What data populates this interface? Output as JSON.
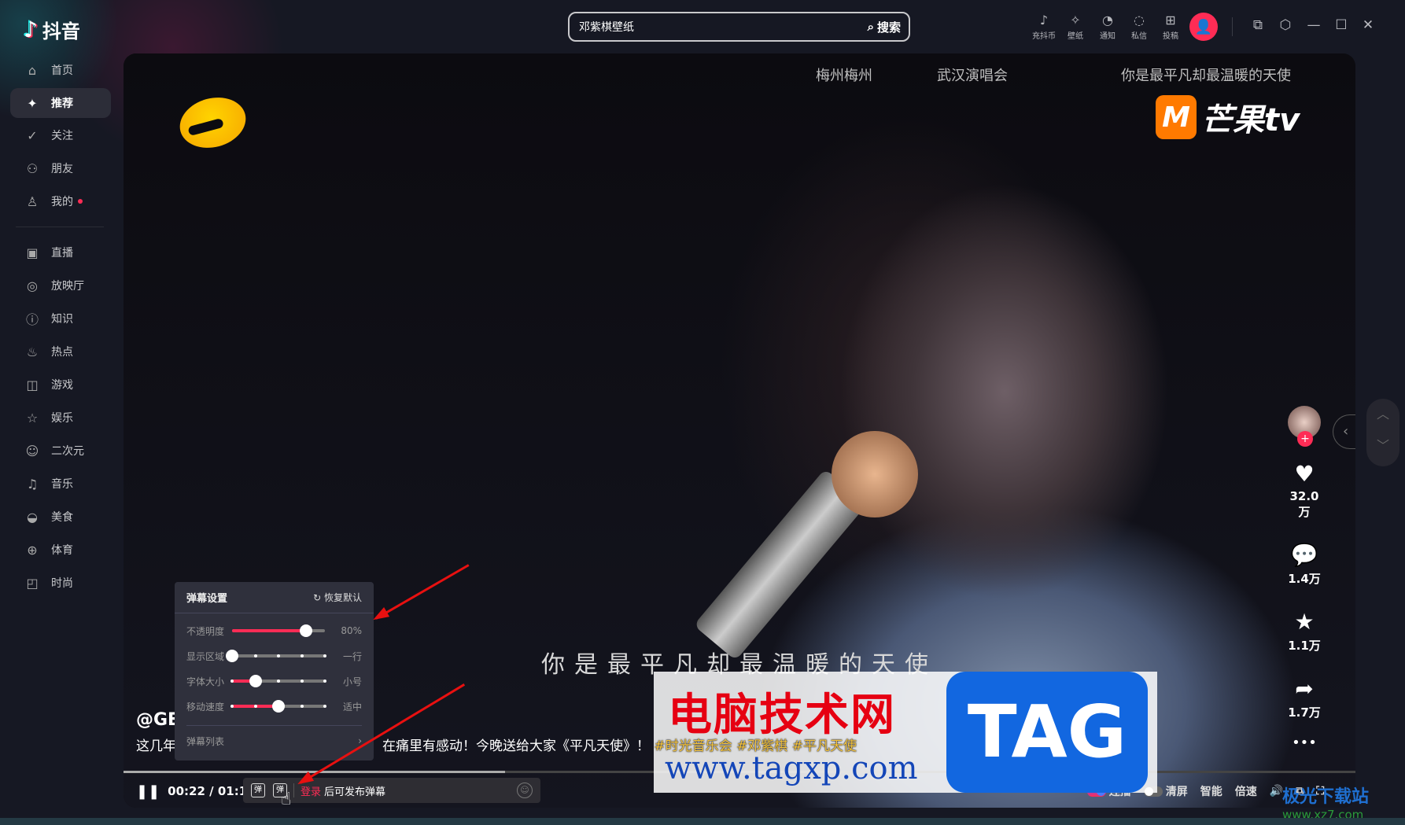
{
  "app": {
    "name": "抖音"
  },
  "search": {
    "value": "邓紫棋壁纸",
    "button": "搜索"
  },
  "top_icons": [
    {
      "icon": "tiktok-coin-icon",
      "label": "充抖币"
    },
    {
      "icon": "wallpaper-icon",
      "label": "壁纸"
    },
    {
      "icon": "bell-icon",
      "label": "通知"
    },
    {
      "icon": "chat-icon",
      "label": "私信"
    },
    {
      "icon": "upload-icon",
      "label": "投稿"
    }
  ],
  "sidebar": {
    "items": [
      {
        "icon": "home-icon",
        "label": "首页"
      },
      {
        "icon": "sparkle-icon",
        "label": "推荐",
        "active": true
      },
      {
        "icon": "follow-icon",
        "label": "关注"
      },
      {
        "icon": "friends-icon",
        "label": "朋友"
      },
      {
        "icon": "user-icon",
        "label": "我的",
        "dot": true
      },
      {
        "icon": "tv-icon",
        "label": "直播"
      },
      {
        "icon": "cinema-icon",
        "label": "放映厅"
      },
      {
        "icon": "knowledge-icon",
        "label": "知识"
      },
      {
        "icon": "fire-icon",
        "label": "热点"
      },
      {
        "icon": "gamepad-icon",
        "label": "游戏"
      },
      {
        "icon": "star-icon",
        "label": "娱乐"
      },
      {
        "icon": "anime-icon",
        "label": "二次元"
      },
      {
        "icon": "music-icon",
        "label": "音乐"
      },
      {
        "icon": "food-icon",
        "label": "美食"
      },
      {
        "icon": "ball-icon",
        "label": "体育"
      },
      {
        "icon": "bag-icon",
        "label": "时尚"
      }
    ]
  },
  "video": {
    "top_tags": [
      "梅州梅州",
      "武汉演唱会",
      "你是最平凡却最温暖的天使"
    ],
    "logo_brand": "芒果tv",
    "subtitle": "你是最平凡却最温暖的天使",
    "author": "@GE",
    "desc_start": "这几年",
    "desc_end": "在痛里有感动！今晚送给大家《平凡天使》！",
    "hashtags": [
      "#时光音乐会",
      "#邓紫棋",
      "#平凡天使"
    ],
    "actions": {
      "likes": "32.0万",
      "comments": "1.4万",
      "favorites": "1.1万",
      "shares": "1.7万"
    },
    "progress": 0.31,
    "time": "00:22 / 01:11",
    "danmaku_login": "登录",
    "danmaku_placeholder": "后可发布弹幕",
    "controls": {
      "autoplay": "连播",
      "clear": "清屏",
      "smart": "智能",
      "speed": "倍速"
    }
  },
  "danmaku_panel": {
    "title": "弹幕设置",
    "reset": "恢复默认",
    "rows": [
      {
        "label": "不透明度",
        "value": "80%",
        "level": 0.8
      },
      {
        "label": "显示区域",
        "value": "一行",
        "level": 0
      },
      {
        "label": "字体大小",
        "value": "小号",
        "level": 0.25
      },
      {
        "label": "移动速度",
        "value": "适中",
        "level": 0.5
      }
    ],
    "list": "弹幕列表"
  },
  "watermark": {
    "cn": "电脑技术网",
    "tag": "TAG",
    "url": "www.tagxp.com",
    "site": "极光下载站",
    "site_url": "www.xz7.com"
  },
  "colors": {
    "accent": "#fe2c55",
    "bg": "#161823"
  }
}
